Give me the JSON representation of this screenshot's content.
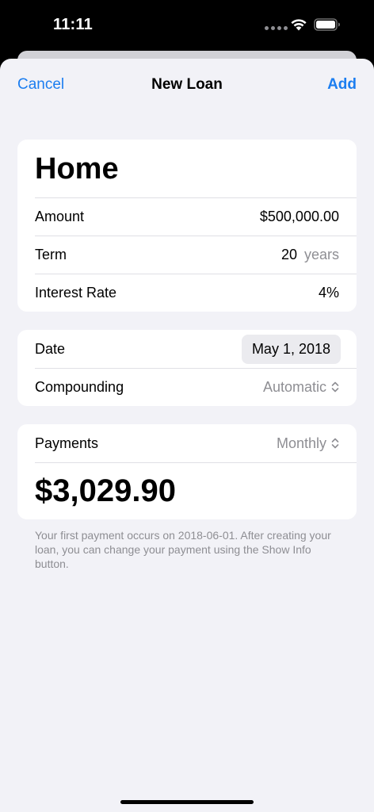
{
  "status_bar": {
    "time": "11:11"
  },
  "nav": {
    "cancel_label": "Cancel",
    "title": "New Loan",
    "add_label": "Add"
  },
  "loan": {
    "name": "Home",
    "amount_label": "Amount",
    "amount_value": "$500,000.00",
    "term_label": "Term",
    "term_value": "20",
    "term_unit": "years",
    "interest_label": "Interest Rate",
    "interest_value": "4%"
  },
  "schedule": {
    "date_label": "Date",
    "date_value": "May 1, 2018",
    "compounding_label": "Compounding",
    "compounding_value": "Automatic"
  },
  "payments": {
    "label": "Payments",
    "frequency": "Monthly",
    "amount": "$3,029.90"
  },
  "footnote": "Your first payment occurs on 2018-06-01. After creating your loan, you can change your payment using the Show Info button.",
  "colors": {
    "accent": "#1c7ef0",
    "background": "#f2f2f7",
    "secondary_text": "#8e8e93"
  },
  "icons": {
    "wifi": "wifi-icon",
    "battery": "battery-icon",
    "picker_chevrons": "chevron-up-down-icon"
  }
}
